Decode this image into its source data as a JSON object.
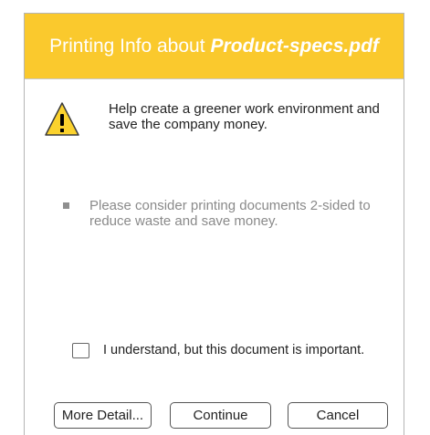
{
  "dialog": {
    "title_prefix": "Printing Info about",
    "title_filename": "Product-specs.pdf",
    "title_color": "#fac92d",
    "icon": "warning-icon",
    "message": "Help create a greener work environment and save the company money.",
    "tip": "Please consider printing documents 2-sided to reduce waste and save money.",
    "checkbox_label": "I understand, but this document is important.",
    "checkbox_checked": false
  },
  "buttons": {
    "more_detail": "More Detail...",
    "continue": "Continue",
    "cancel": "Cancel"
  }
}
